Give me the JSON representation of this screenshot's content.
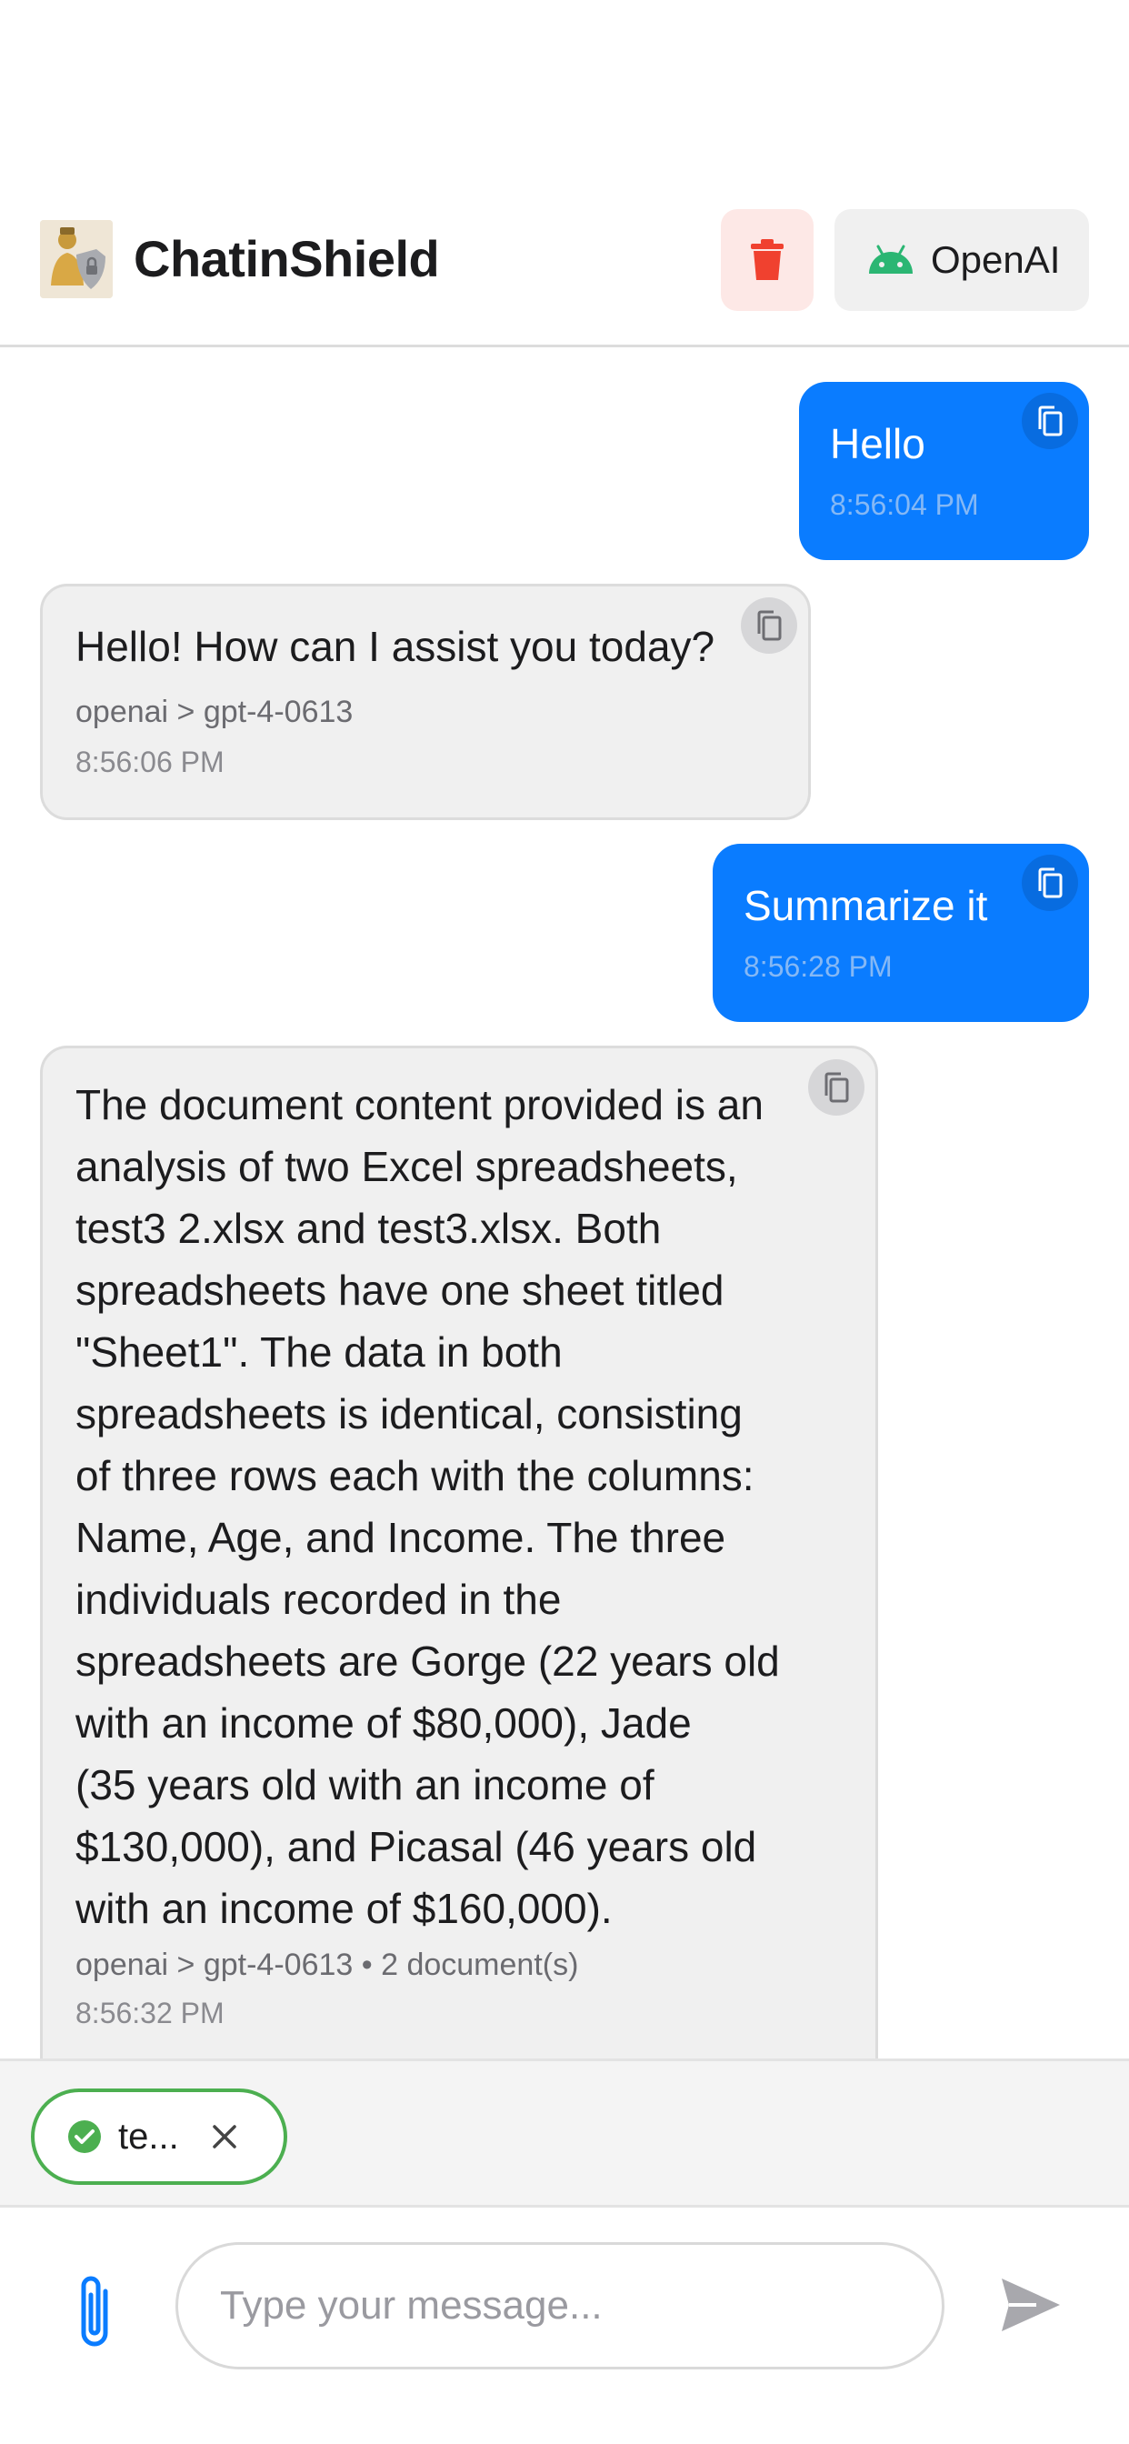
{
  "header": {
    "title": "ChatinShield",
    "provider_label": "OpenAI",
    "colors": {
      "delete": "#f0412f",
      "android": "#2bb673"
    }
  },
  "messages": [
    {
      "role": "user",
      "text": "Hello",
      "time": "8:56:04 PM"
    },
    {
      "role": "assistant",
      "text": "Hello! How can I assist you today?",
      "meta": "openai > gpt-4-0613",
      "time": "8:56:06 PM"
    },
    {
      "role": "user",
      "text": "Summarize it",
      "time": "8:56:28 PM"
    },
    {
      "role": "assistant",
      "lines": [
        "The document content provided is an",
        "analysis of two Excel spreadsheets,",
        "test3 2.xlsx and test3.xlsx. Both",
        "spreadsheets have one sheet titled",
        "\"Sheet1\". The data in both",
        "spreadsheets is identical, consisting",
        "of three rows each with the columns:",
        "Name, Age, and Income. The three",
        "individuals recorded in the",
        "spreadsheets are Gorge (22 years old",
        "with an income of $80,000), Jade",
        "(35 years old with an income of",
        "$130,000), and Picasal (46 years old",
        "with an income of $160,000)."
      ],
      "meta": "openai > gpt-4-0613 • 2 document(s)",
      "time": "8:56:32 PM"
    }
  ],
  "attachment": {
    "label": "te...",
    "status_color": "#4caf50"
  },
  "composer": {
    "placeholder": "Type your message...",
    "accent": "#0a7cff"
  }
}
